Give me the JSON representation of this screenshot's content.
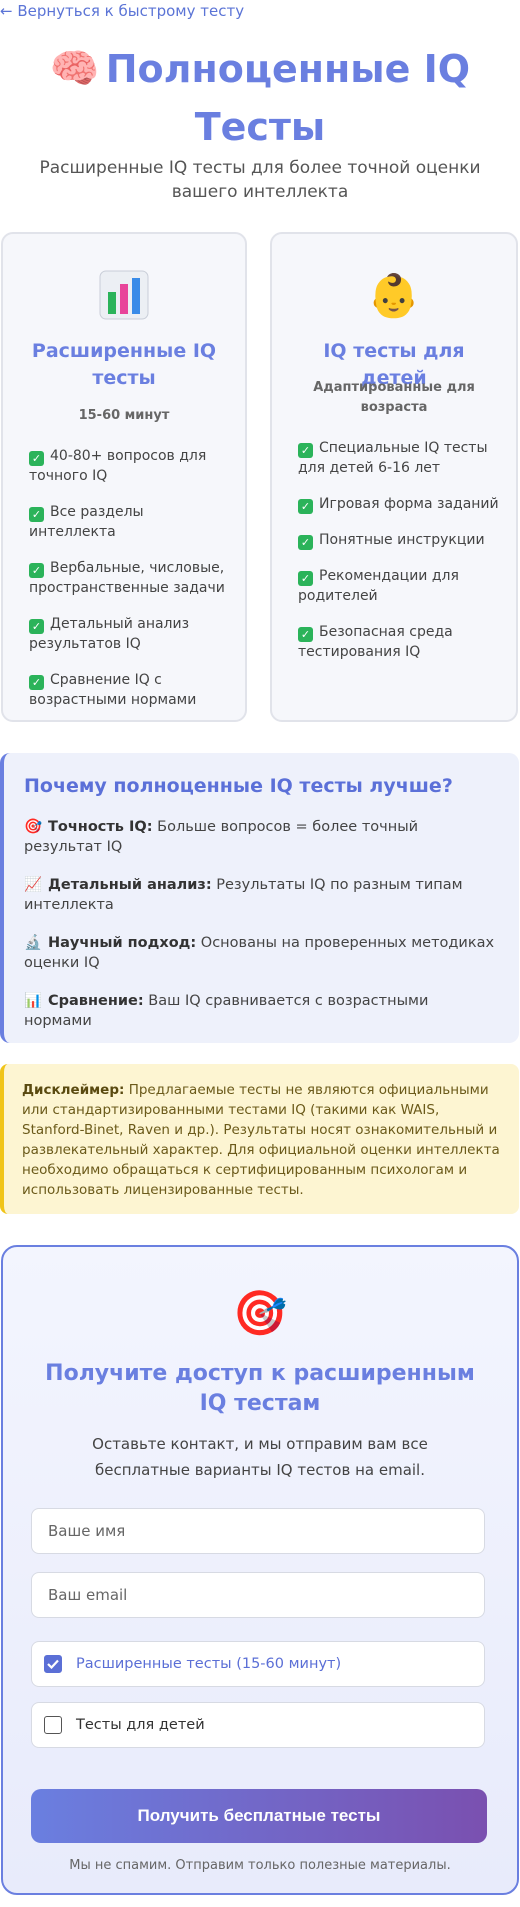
{
  "back_link": "← Вернуться к быстрому тесту",
  "hero": {
    "title": "Полноценные IQ Тесты",
    "subtitle": "Расширенные IQ тесты для более точной оценки вашего интеллекта"
  },
  "cards": [
    {
      "icon": "bar-chart-icon",
      "title": "Расширенные IQ тесты",
      "meta": "15-60 минут",
      "features": [
        "40-80+ вопросов для точного IQ",
        "Все разделы интеллекта",
        "Вербальные, числовые, пространственные задачи",
        "Детальный анализ результатов IQ",
        "Сравнение IQ с возрастными нормами"
      ]
    },
    {
      "icon": "baby-face-icon",
      "title": "IQ тесты для детей",
      "meta": "Адаптированные для возраста",
      "features": [
        "Специальные IQ тесты для детей 6-16 лет",
        "Игровая форма заданий",
        "Понятные инструкции",
        "Рекомендации для родителей",
        "Безопасная среда тестирования IQ"
      ]
    }
  ],
  "why": {
    "title": "Почему полноценные IQ тесты лучше?",
    "items": [
      {
        "icon": "target-icon",
        "label": "Точность IQ:",
        "text": "Больше вопросов = более точный результат IQ"
      },
      {
        "icon": "trend-chart-icon",
        "label": "Детальный анализ:",
        "text": "Результаты IQ по разным типам интеллекта"
      },
      {
        "icon": "microscope-icon",
        "label": "Научный подход:",
        "text": "Основаны на проверенных методиках оценки IQ"
      },
      {
        "icon": "bar-chart-icon",
        "label": "Сравнение:",
        "text": "Ваш IQ сравнивается с возрастными нормами"
      }
    ]
  },
  "disclaimer": {
    "label": "Дисклеймер:",
    "text": "Предлагаемые тесты не являются официальными или стандартизированными тестами IQ (такими как WAIS, Stanford-Binet, Raven и др.). Результаты носят ознакомительный и развлекательный характер. Для официальной оценки интеллекта необходимо обращаться к сертифицированным психологам и использовать лицензированные тесты."
  },
  "cta": {
    "title": "Получите доступ к расширенным IQ тестам",
    "text": "Оставьте контакт, и мы отправим вам все бесплатные варианты IQ тестов на email.",
    "name_placeholder": "Ваше имя",
    "email_placeholder": "Ваш email",
    "option_extended": "Расширенные тесты (15-60 минут)",
    "option_extended_checked": true,
    "option_kids": "Тесты для детей",
    "option_kids_checked": false,
    "submit": "Получить бесплатные тесты",
    "note": "Мы не спамим. Отправим только полезные материалы."
  },
  "colors": {
    "accent": "#6a7fe0",
    "check": "#2bb35a",
    "warning_border": "#f0c419",
    "button_gradient_end": "#7a50b0"
  }
}
